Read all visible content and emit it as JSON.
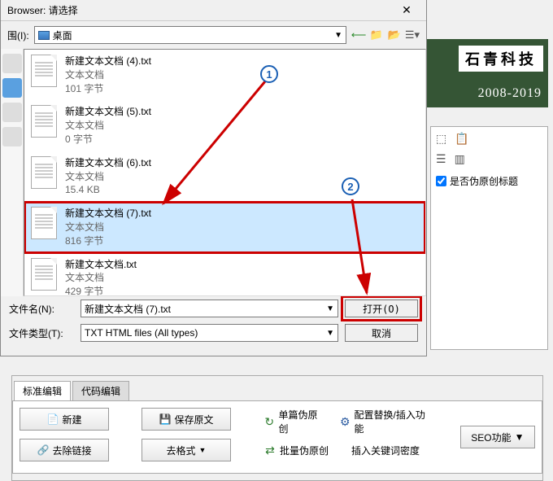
{
  "dialog": {
    "title": "Browser: 请选择",
    "look_in_label": "围(I):",
    "look_in_value": "桌面",
    "files": [
      {
        "name": "新建文本文档 (4).txt",
        "type": "文本文档",
        "size": "101 字节"
      },
      {
        "name": "新建文本文档 (5).txt",
        "type": "文本文档",
        "size": "0 字节"
      },
      {
        "name": "新建文本文档 (6).txt",
        "type": "文本文档",
        "size": "15.4 KB"
      },
      {
        "name": "新建文本文档 (7).txt",
        "type": "文本文档",
        "size": "816 字节"
      },
      {
        "name": "新建文本文档.txt",
        "type": "文本文档",
        "size": "429 字节"
      }
    ],
    "filename_label": "文件名(N):",
    "filename_value": "新建文本文档 (7).txt",
    "filetype_label": "文件类型(T):",
    "filetype_value": "TXT HTML files (All types)",
    "open_btn": "打开(O)",
    "cancel_btn": "取消"
  },
  "markers": {
    "one": "1",
    "two": "2"
  },
  "banner": {
    "logo": "石青科技",
    "years": "2008-2019"
  },
  "rightpanel": {
    "checkbox_label": "是否伪原创标题"
  },
  "tabs": {
    "t1": "标准编辑",
    "t2": "代码编辑"
  },
  "buttons": {
    "new": "新建",
    "save": "保存原文",
    "dellink": "去除链接",
    "defmt": "去格式",
    "single": "单篇伪原创",
    "config": "配置替换/插入功能",
    "batch": "批量伪原创",
    "keyword": "插入关键词密度",
    "seo": "SEO功能"
  }
}
